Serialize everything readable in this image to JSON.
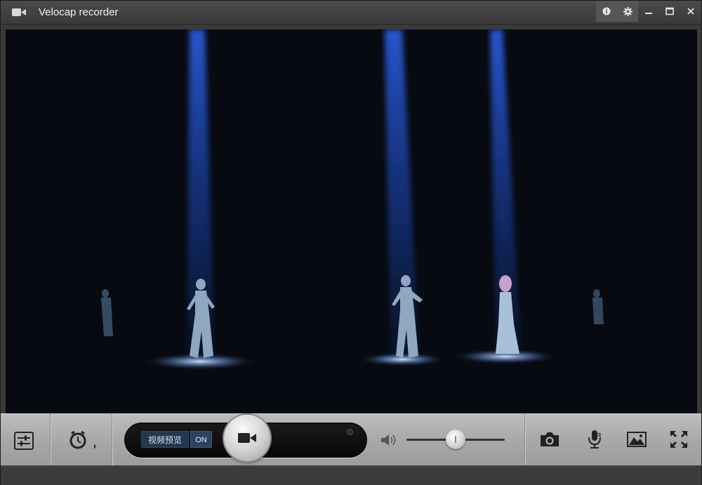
{
  "window": {
    "title": "Velocap recorder",
    "icons": [
      "video-camera-icon",
      "info-icon",
      "gear-icon",
      "minimize-icon",
      "maximize-icon",
      "close-icon"
    ]
  },
  "controls": {
    "settings_icon": "sliders-icon",
    "schedule_icon": "alarm-clock-icon",
    "preview_label": "视频预览",
    "preview_toggle": "ON",
    "record_icon": "video-camera-icon",
    "volume_icon": "speaker-icon",
    "volume_level": 0.5,
    "screenshot_icon": "camera-icon",
    "mic_icon": "microphone-icon",
    "gallery_icon": "image-icon",
    "fullscreen_icon": "fullscreen-icon"
  },
  "colors": {
    "titlebar": "#3a3a3a",
    "controlbar": "#a9a9a9",
    "toggle_blue": "#2a4460",
    "spotlight": "#1e4fc8"
  }
}
